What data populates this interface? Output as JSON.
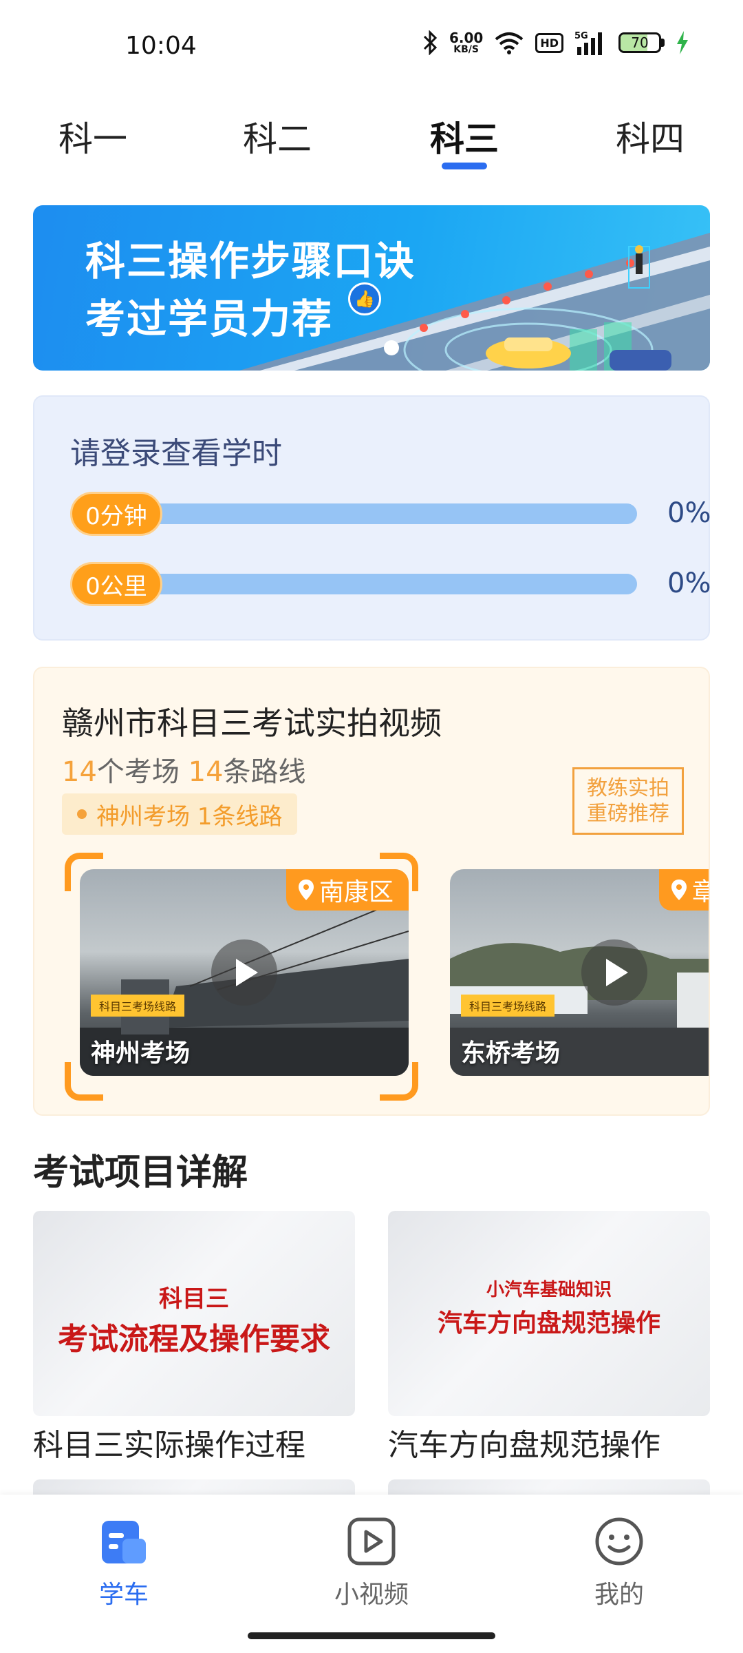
{
  "status_bar": {
    "time": "10:04",
    "net_speed_value": "6.00",
    "net_speed_unit": "KB/S",
    "hd_label": "HD",
    "signal_label": "5G",
    "battery_level": "70",
    "battery_fraction": 0.7
  },
  "tabs": [
    {
      "label": "科一",
      "active": false
    },
    {
      "label": "科二",
      "active": false
    },
    {
      "label": "科三",
      "active": true
    },
    {
      "label": "科四",
      "active": false
    }
  ],
  "banner": {
    "line1": "科三操作步骤口诀",
    "line2": "考过学员力荐",
    "thumb_icon": "thumbs-up-icon"
  },
  "study_time": {
    "title": "请登录查看学时",
    "rows": [
      {
        "value_label": "0分钟",
        "percent_label": "0%",
        "fraction": 0
      },
      {
        "value_label": "0公里",
        "percent_label": "0%",
        "fraction": 0
      }
    ]
  },
  "exam_videos": {
    "title": "赣州市科目三考试实拍视频",
    "venues_count": "14",
    "venues_suffix": "个考场 ",
    "routes_count": "14",
    "routes_suffix": "条路线",
    "chip": "神州考场 1条线路",
    "coach_badge_line1": "教练实拍",
    "coach_badge_line2": "重磅推荐",
    "videos": [
      {
        "location": "南康区",
        "tag": "科目三考场线路",
        "name": "神州考场"
      },
      {
        "location": "章",
        "tag": "科目三考场线路",
        "name": "东桥考场"
      }
    ]
  },
  "section_title": "考试项目详解",
  "courses": [
    {
      "subtitle": "科目三",
      "headline": "考试流程及操作要求",
      "label": "科目三实际操作过程"
    },
    {
      "subtitle": "小汽车基础知识",
      "headline": "汽车方向盘规范操作",
      "label": "汽车方向盘规范操作"
    }
  ],
  "bottom_nav": [
    {
      "label": "学车",
      "icon": "learn-car-icon",
      "active": true
    },
    {
      "label": "小视频",
      "icon": "video-play-icon",
      "active": false
    },
    {
      "label": "我的",
      "icon": "smiley-icon",
      "active": false
    }
  ],
  "colors": {
    "accent": "#2b6df0",
    "orange": "#ff9a1f",
    "title_red": "#c91818"
  }
}
